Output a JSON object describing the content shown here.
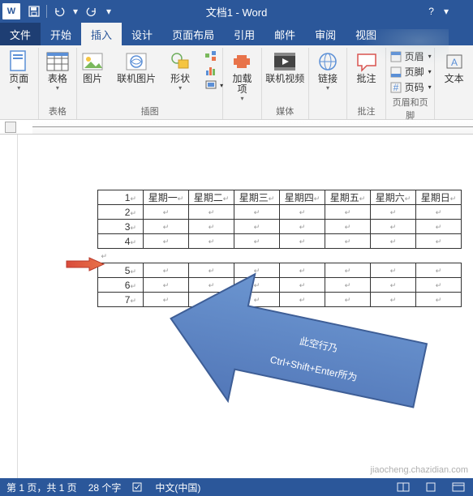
{
  "title": "文档1 - Word",
  "qat": {
    "save": "保存",
    "undo": "撤销",
    "redo": "重做"
  },
  "help_icon": "?",
  "tabs": [
    "文件",
    "开始",
    "插入",
    "设计",
    "页面布局",
    "引用",
    "邮件",
    "审阅",
    "视图"
  ],
  "active_tab": 2,
  "ribbon": {
    "page_group": {
      "page": "页面",
      "label": ""
    },
    "table_group": {
      "table": "表格",
      "label": "表格"
    },
    "illust_group": {
      "pic": "图片",
      "online_pic": "联机图片",
      "shapes": "形状",
      "label": "插图"
    },
    "addin_group": {
      "addin": "加载\n项",
      "label": ""
    },
    "media_group": {
      "video": "联机视频",
      "label": "媒体"
    },
    "link_group": {
      "link": "链接",
      "label": ""
    },
    "comment_group": {
      "comment": "批注",
      "label": "批注"
    },
    "hf_group": {
      "header": "页眉",
      "footer": "页脚",
      "pagenum": "页码",
      "label": "页眉和页脚"
    },
    "text_group": {
      "textbox": "文本"
    }
  },
  "table": {
    "headers": [
      "",
      "星期一",
      "星期二",
      "星期三",
      "星期四",
      "星期五",
      "星期六",
      "星期日"
    ],
    "rows1": [
      "1",
      "2",
      "3",
      "4"
    ],
    "rows2": [
      "5",
      "6",
      "7"
    ]
  },
  "callout": {
    "line1": "此空行乃",
    "line2": "Ctrl+Shift+Enter所为"
  },
  "status": {
    "page": "第 1 页，共 1 页",
    "words": "28 个字",
    "lang": "中文(中国)"
  },
  "watermark": "jiaocheng.chazidian.com"
}
